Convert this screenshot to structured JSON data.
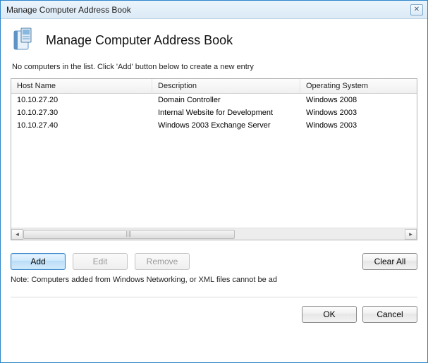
{
  "window": {
    "title": "Manage Computer Address Book"
  },
  "header": {
    "heading": "Manage Computer Address Book"
  },
  "helper": "No computers in the list. Click 'Add' button below to create a new entry",
  "table": {
    "columns": {
      "host": "Host Name",
      "desc": "Description",
      "os": "Operating System"
    },
    "rows": [
      {
        "host": "10.10.27.20",
        "desc": "Domain Controller",
        "os": "Windows 2008"
      },
      {
        "host": "10.10.27.30",
        "desc": "Internal Website for Development",
        "os": "Windows 2003"
      },
      {
        "host": "10.10.27.40",
        "desc": "Windows 2003 Exchange Server",
        "os": "Windows 2003"
      }
    ]
  },
  "buttons": {
    "add": "Add",
    "edit": "Edit",
    "remove": "Remove",
    "clear_all": "Clear All",
    "ok": "OK",
    "cancel": "Cancel"
  },
  "note": "Note: Computers added from Windows Networking, or XML files cannot be ad"
}
